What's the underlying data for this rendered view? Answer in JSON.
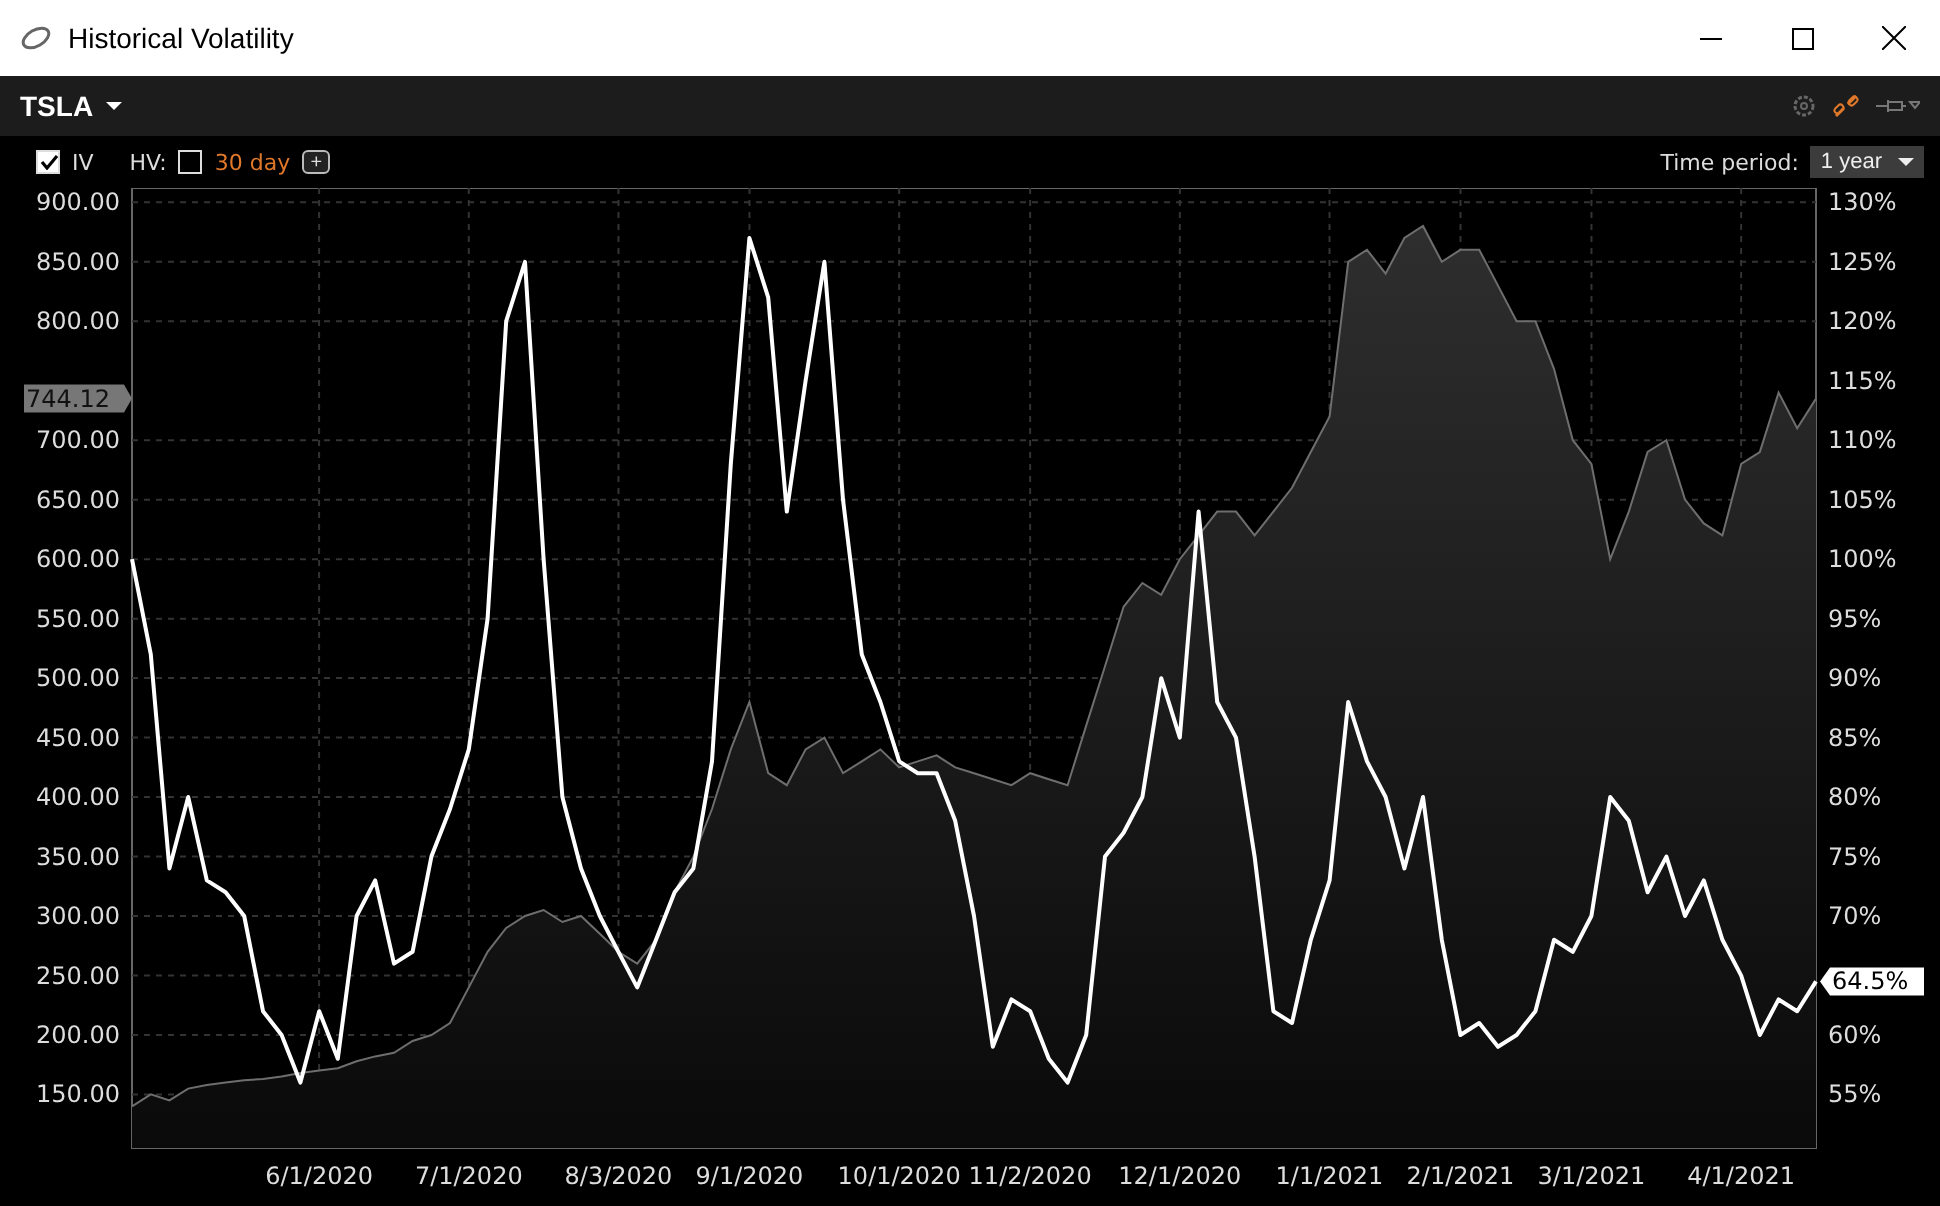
{
  "window": {
    "title": "Historical Volatility"
  },
  "symbol": {
    "label": "TSLA"
  },
  "toolbar": {
    "iv": {
      "label": "IV",
      "checked": true
    },
    "hv": {
      "label": "HV:",
      "checked": false,
      "period": "30 day",
      "add": "+"
    },
    "time_period": {
      "label": "Time period:",
      "value": "1 year"
    }
  },
  "chart_data": {
    "type": "line",
    "grid": true,
    "ylim": [
      105,
      912
    ],
    "y2lim": [
      50.5,
      131.2
    ],
    "categories": [
      null,
      null,
      null,
      null,
      null,
      null,
      null,
      null,
      null,
      null,
      "6/1/2020",
      null,
      null,
      null,
      null,
      null,
      null,
      null,
      "7/1/2020",
      null,
      null,
      null,
      null,
      null,
      null,
      null,
      "8/3/2020",
      null,
      null,
      null,
      null,
      null,
      null,
      "9/1/2020",
      null,
      null,
      null,
      null,
      null,
      null,
      null,
      "10/1/2020",
      null,
      null,
      null,
      null,
      null,
      null,
      "11/2/2020",
      null,
      null,
      null,
      null,
      null,
      null,
      null,
      "12/1/2020",
      null,
      null,
      null,
      null,
      null,
      null,
      null,
      "1/1/2021",
      null,
      null,
      null,
      null,
      null,
      null,
      "2/1/2021",
      null,
      null,
      null,
      null,
      null,
      null,
      "3/1/2021",
      null,
      null,
      null,
      null,
      null,
      null,
      null,
      "4/1/2021",
      null,
      null,
      null,
      null
    ],
    "series": [
      {
        "type": "area",
        "color": "#6e6e6e",
        "values": [
          140,
          150,
          145,
          155,
          158,
          160,
          162,
          163,
          165,
          168,
          170,
          172,
          178,
          182,
          185,
          195,
          200,
          210,
          240,
          270,
          290,
          300,
          305,
          295,
          300,
          285,
          270,
          260,
          280,
          320,
          350,
          390,
          440,
          480,
          420,
          410,
          440,
          450,
          420,
          430,
          440,
          425,
          430,
          435,
          425,
          420,
          415,
          410,
          420,
          415,
          410,
          460,
          510,
          560,
          580,
          570,
          600,
          620,
          640,
          640,
          620,
          640,
          660,
          690,
          720,
          850,
          860,
          840,
          870,
          880,
          850,
          860,
          860,
          830,
          800,
          800,
          760,
          700,
          680,
          600,
          640,
          690,
          700,
          650,
          630,
          620,
          680,
          690,
          740,
          710,
          735
        ]
      },
      {
        "color": "#ffffff",
        "axis": "y2",
        "values": [
          100,
          92,
          74,
          80,
          73,
          72,
          70,
          62,
          60,
          56,
          62,
          58,
          70,
          73,
          66,
          67,
          75,
          79,
          84,
          95,
          120,
          125,
          100,
          80,
          74,
          70,
          67,
          64,
          68,
          72,
          74,
          83,
          108,
          127,
          122,
          104,
          115,
          125,
          105,
          92,
          88,
          83,
          82,
          82,
          78,
          70,
          59,
          63,
          62,
          58,
          56,
          60,
          75,
          77,
          80,
          90,
          85,
          104,
          88,
          85,
          75,
          62,
          61,
          68,
          73,
          88,
          83,
          80,
          74,
          80,
          68,
          60,
          61,
          59,
          60,
          62,
          68,
          67,
          70,
          80,
          78,
          72,
          75,
          70,
          73,
          68,
          65,
          60,
          63,
          62,
          64.5
        ]
      }
    ],
    "yticks": [
      {
        "value": 150,
        "label": "150.00"
      },
      {
        "value": 200,
        "label": "200.00"
      },
      {
        "value": 250,
        "label": "250.00"
      },
      {
        "value": 300,
        "label": "300.00"
      },
      {
        "value": 350,
        "label": "350.00"
      },
      {
        "value": 400,
        "label": "400.00"
      },
      {
        "value": 450,
        "label": "450.00"
      },
      {
        "value": 500,
        "label": "500.00"
      },
      {
        "value": 550,
        "label": "550.00"
      },
      {
        "value": 600,
        "label": "600.00"
      },
      {
        "value": 650,
        "label": "650.00"
      },
      {
        "value": 700,
        "label": "700.00"
      },
      {
        "value": 800,
        "label": "800.00"
      },
      {
        "value": 850,
        "label": "850.00"
      },
      {
        "value": 900,
        "label": "900.00"
      }
    ],
    "y2ticks": [
      {
        "value": 55,
        "label": "55%"
      },
      {
        "value": 60,
        "label": "60%"
      },
      {
        "value": 70,
        "label": "70%"
      },
      {
        "value": 75,
        "label": "75%"
      },
      {
        "value": 80,
        "label": "80%"
      },
      {
        "value": 85,
        "label": "85%"
      },
      {
        "value": 90,
        "label": "90%"
      },
      {
        "value": 95,
        "label": "95%"
      },
      {
        "value": 100,
        "label": "100%"
      },
      {
        "value": 105,
        "label": "105%"
      },
      {
        "value": 110,
        "label": "110%"
      },
      {
        "value": 115,
        "label": "115%"
      },
      {
        "value": 120,
        "label": "120%"
      },
      {
        "value": 125,
        "label": "125%"
      },
      {
        "value": 130,
        "label": "130%"
      }
    ],
    "annotations": [
      "744.12",
      "64.5%"
    ]
  }
}
